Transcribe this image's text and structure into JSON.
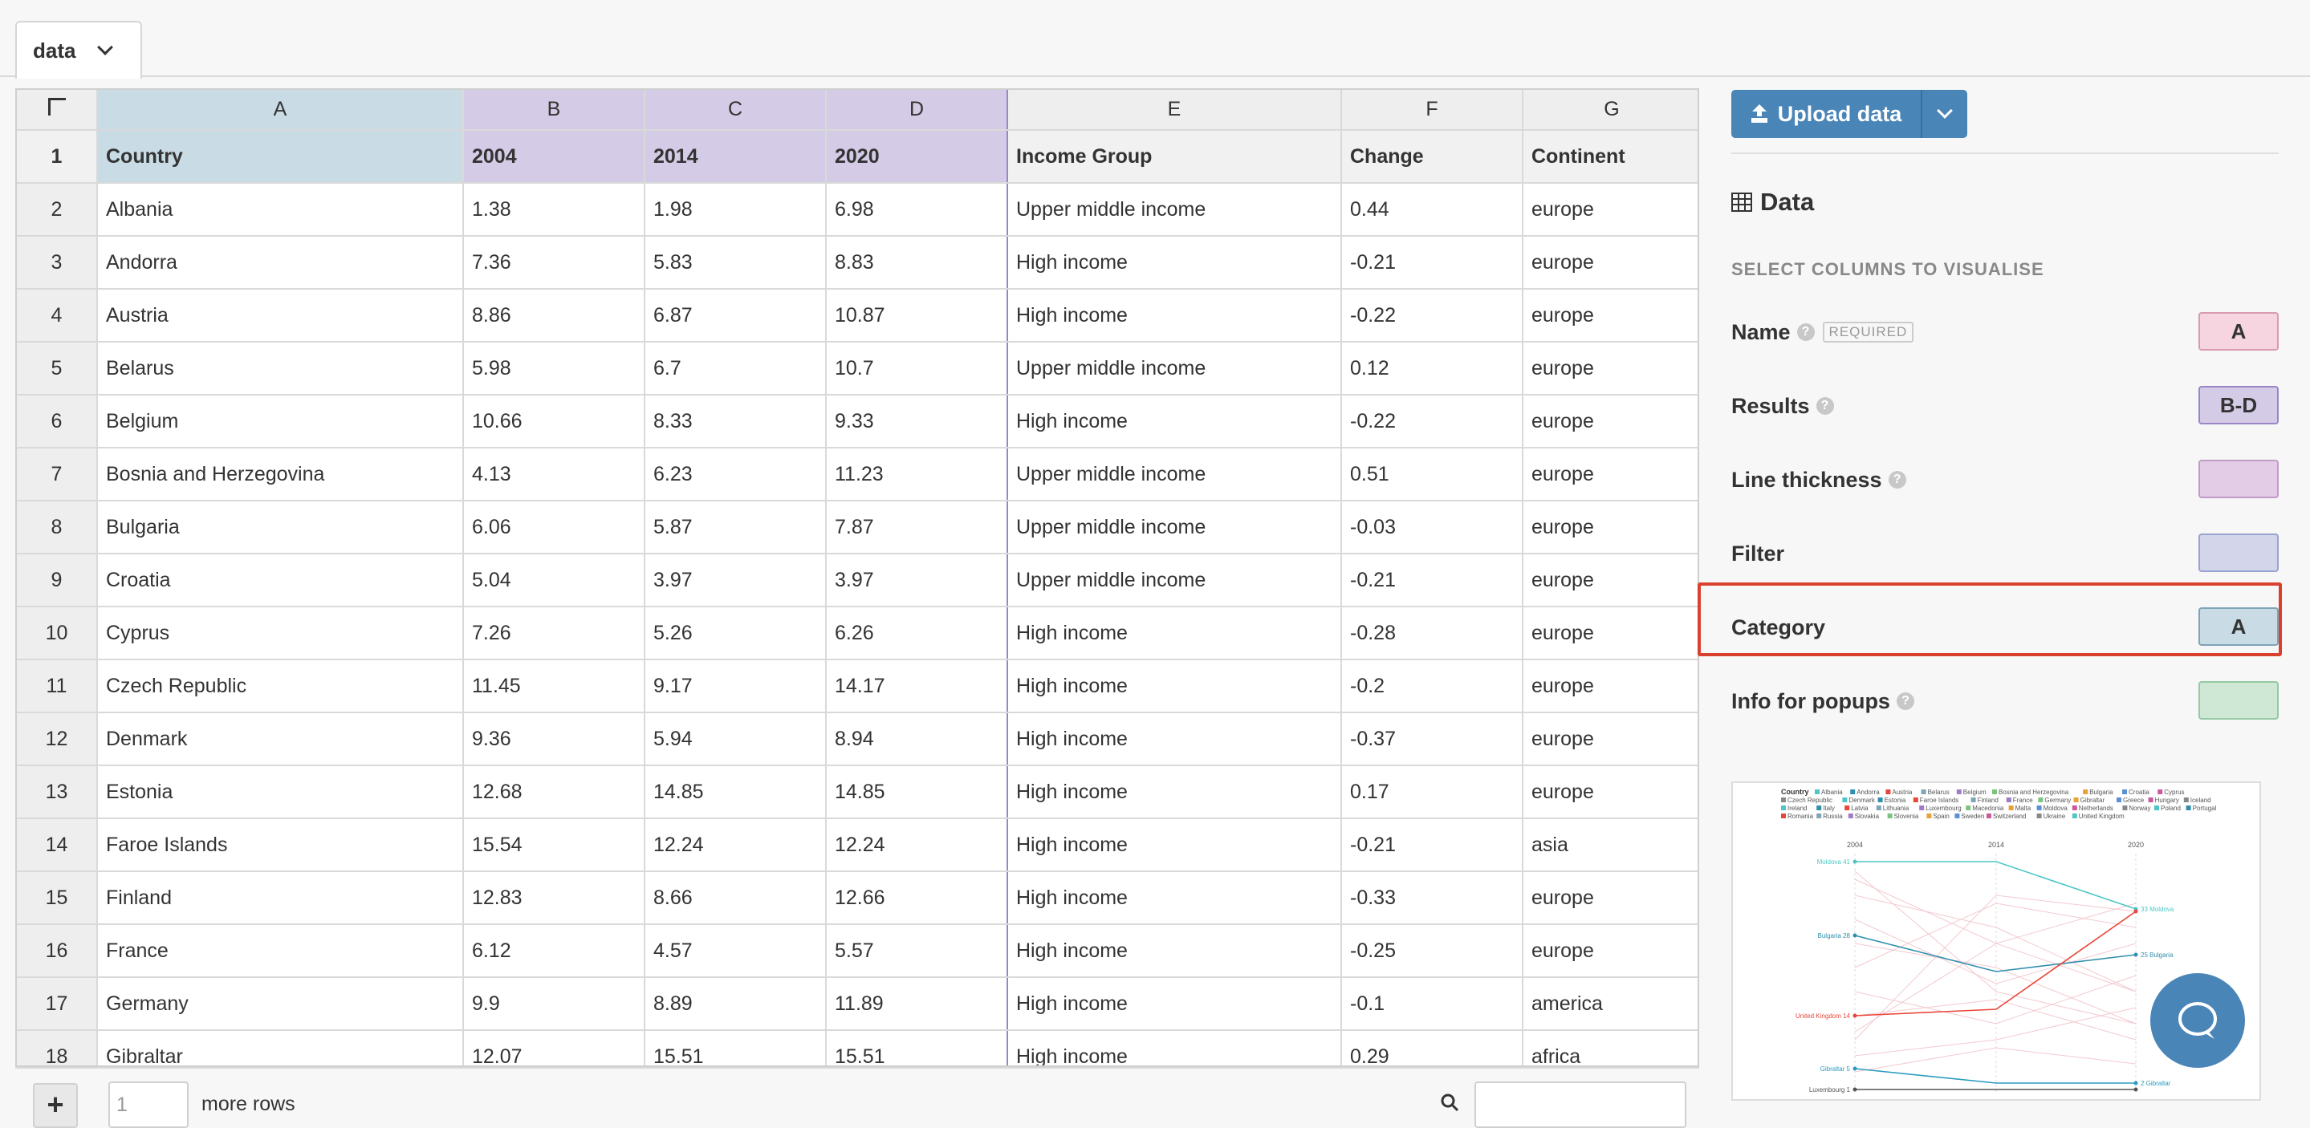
{
  "tabs": [
    {
      "label": "data"
    }
  ],
  "grid": {
    "columns": [
      "A",
      "B",
      "C",
      "D",
      "E",
      "F",
      "G"
    ],
    "header_row": [
      "Country",
      "2004",
      "2014",
      "2020",
      "Income Group",
      "Change",
      "Continent"
    ],
    "rows": [
      {
        "n": "2",
        "cells": [
          "Albania",
          "1.38",
          "1.98",
          "6.98",
          "Upper middle income",
          "0.44",
          "europe"
        ]
      },
      {
        "n": "3",
        "cells": [
          "Andorra",
          "7.36",
          "5.83",
          "8.83",
          "High income",
          "-0.21",
          "europe"
        ]
      },
      {
        "n": "4",
        "cells": [
          "Austria",
          "8.86",
          "6.87",
          "10.87",
          "High income",
          "-0.22",
          "europe"
        ]
      },
      {
        "n": "5",
        "cells": [
          "Belarus",
          "5.98",
          "6.7",
          "10.7",
          "Upper middle income",
          "0.12",
          "europe"
        ]
      },
      {
        "n": "6",
        "cells": [
          "Belgium",
          "10.66",
          "8.33",
          "9.33",
          "High income",
          "-0.22",
          "europe"
        ]
      },
      {
        "n": "7",
        "cells": [
          "Bosnia and Herzegovina",
          "4.13",
          "6.23",
          "11.23",
          "Upper middle income",
          "0.51",
          "europe"
        ]
      },
      {
        "n": "8",
        "cells": [
          "Bulgaria",
          "6.06",
          "5.87",
          "7.87",
          "Upper middle income",
          "-0.03",
          "europe"
        ]
      },
      {
        "n": "9",
        "cells": [
          "Croatia",
          "5.04",
          "3.97",
          "3.97",
          "Upper middle income",
          "-0.21",
          "europe"
        ]
      },
      {
        "n": "10",
        "cells": [
          "Cyprus",
          "7.26",
          "5.26",
          "6.26",
          "High income",
          "-0.28",
          "europe"
        ]
      },
      {
        "n": "11",
        "cells": [
          "Czech Republic",
          "11.45",
          "9.17",
          "14.17",
          "High income",
          "-0.2",
          "europe"
        ]
      },
      {
        "n": "12",
        "cells": [
          "Denmark",
          "9.36",
          "5.94",
          "8.94",
          "High income",
          "-0.37",
          "europe"
        ]
      },
      {
        "n": "13",
        "cells": [
          "Estonia",
          "12.68",
          "14.85",
          "14.85",
          "High income",
          "0.17",
          "europe"
        ]
      },
      {
        "n": "14",
        "cells": [
          "Faroe Islands",
          "15.54",
          "12.24",
          "12.24",
          "High income",
          "-0.21",
          "asia"
        ]
      },
      {
        "n": "15",
        "cells": [
          "Finland",
          "12.83",
          "8.66",
          "12.66",
          "High income",
          "-0.33",
          "europe"
        ]
      },
      {
        "n": "16",
        "cells": [
          "France",
          "6.12",
          "4.57",
          "5.57",
          "High income",
          "-0.25",
          "europe"
        ]
      },
      {
        "n": "17",
        "cells": [
          "Germany",
          "9.9",
          "8.89",
          "11.89",
          "High income",
          "-0.1",
          "america"
        ]
      },
      {
        "n": "18",
        "cells": [
          "Gibraltar",
          "12.07",
          "15.51",
          "15.51",
          "High income",
          "0.29",
          "africa"
        ]
      }
    ]
  },
  "bottombar": {
    "rows_value": "1",
    "more_rows_label": "more rows"
  },
  "panel": {
    "upload_label": "Upload data",
    "data_title": "Data",
    "select_columns_label": "SELECT COLUMNS TO VISUALISE",
    "bindings": [
      {
        "label": "Name",
        "badge": "REQUIRED",
        "help": true,
        "value": "A",
        "color": "#f6d5e1",
        "border": "#d89bb2"
      },
      {
        "label": "Results",
        "help": true,
        "value": "B-D",
        "color": "#d4cbe6",
        "border": "#9a86c5"
      },
      {
        "label": "Line thickness",
        "help": true,
        "value": "",
        "color": "#e3cde6",
        "border": "#c29ac8"
      },
      {
        "label": "Filter",
        "value": "",
        "color": "#d3d6ea",
        "border": "#9aa2cf"
      },
      {
        "label": "Category",
        "value": "A",
        "color": "#c9dbe4",
        "border": "#7fa3b7"
      },
      {
        "label": "Info for popups",
        "help": true,
        "value": "",
        "color": "#cfe8d6",
        "border": "#95c9a3"
      }
    ]
  },
  "preview_chart": {
    "legend_title": "Country",
    "legend_items": [
      "Albania",
      "Andorra",
      "Austria",
      "Belarus",
      "Belgium",
      "Bosnia and Herzegovina",
      "Bulgaria",
      "Croatia",
      "Cyprus",
      "Czech Republic",
      "Denmark",
      "Estonia",
      "Faroe Islands",
      "Finland",
      "France",
      "Germany",
      "Gibraltar",
      "Greece",
      "Hungary",
      "Iceland",
      "Ireland",
      "Italy",
      "Latvia",
      "Lithuania",
      "Luxembourg",
      "Macedonia",
      "Malta",
      "Moldova",
      "Netherlands",
      "Norway",
      "Poland",
      "Portugal",
      "Romania",
      "Russia",
      "Slovakia",
      "Slovenia",
      "Spain",
      "Sweden",
      "Switzerland",
      "Ukraine",
      "United Kingdom"
    ],
    "axis_labels": [
      "2004",
      "2014",
      "2020"
    ],
    "left_labels": [
      "Moldova 41",
      "Bulgaria 28",
      "United Kingdom 14",
      "Gibraltar 5",
      "Luxembourg 1"
    ],
    "right_labels": [
      "33 Moldova",
      "25 Bulgaria",
      "2 Gibraltar"
    ],
    "colors": {
      "moldova": "#4ec6c6",
      "bulgaria": "#2f8fad",
      "uk": "#e8463a",
      "gibraltar": "#2a9bbf",
      "luxembourg": "#555555",
      "accent": "#4a85b8",
      "highlight": "#d9412e"
    }
  }
}
